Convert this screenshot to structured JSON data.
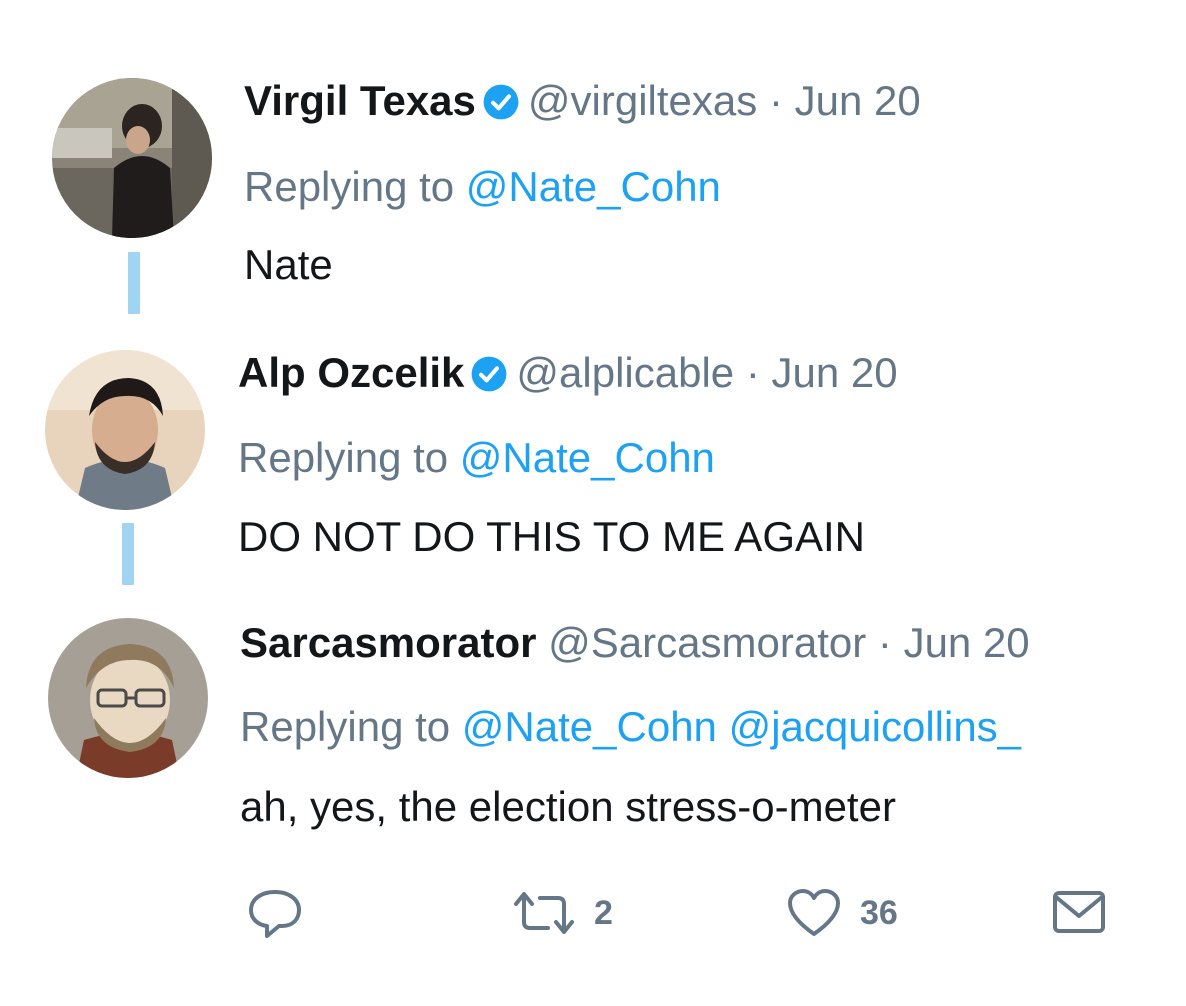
{
  "tweets": [
    {
      "name": "Virgil Texas",
      "verified": true,
      "handle": "@virgiltexas",
      "separator": "·",
      "date": "Jun 20",
      "replying_prefix": "Replying to",
      "mentions": [
        "@Nate_Cohn"
      ],
      "text": "Nate"
    },
    {
      "name": "Alp Ozcelik",
      "verified": true,
      "handle": "@alplicable",
      "separator": "·",
      "date": "Jun 20",
      "replying_prefix": "Replying to",
      "mentions": [
        "@Nate_Cohn"
      ],
      "text": "DO NOT DO THIS TO ME AGAIN"
    },
    {
      "name": "Sarcasmorator",
      "verified": false,
      "handle": "@Sarcasmorator",
      "separator": "·",
      "date": "Jun 20",
      "replying_prefix": "Replying to",
      "mentions": [
        "@Nate_Cohn",
        "@jacquicollins_"
      ],
      "text": "ah, yes, the election stress-o-meter"
    }
  ],
  "actions": {
    "reply_icon": "reply-icon",
    "retweet_icon": "retweet-icon",
    "retweet_count": "2",
    "like_icon": "heart-icon",
    "like_count": "36",
    "dm_icon": "envelope-icon"
  },
  "colors": {
    "name": "#14171a",
    "meta": "#657786",
    "link": "#1da1f2",
    "thread_line": "#9fd5f2"
  }
}
